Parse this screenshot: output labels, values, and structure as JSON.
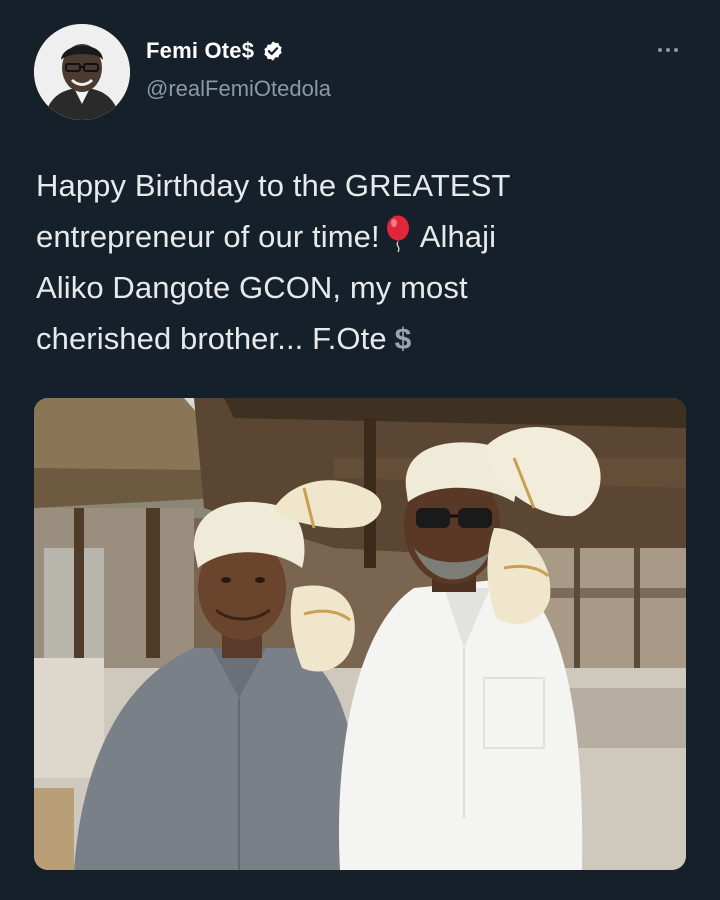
{
  "tweet": {
    "author": {
      "display_name": "Femi Ote$",
      "handle": "@realFemiOtedola",
      "verified": true
    },
    "text": {
      "line1": "Happy Birthday to the GREATEST",
      "line2_start": "entrepreneur of our time!",
      "line2_end": "Alhaji",
      "line3": "Aliko Dangote GCON, my most",
      "line4": "cherished brother... F.Ote",
      "line4_symbol": "$"
    },
    "icons": {
      "more": "more-options-icon",
      "verified": "verified-badge-icon",
      "emoji": "balloon-emoji-icon"
    },
    "colors": {
      "background": "#15202b",
      "text": "#e7e9ea",
      "secondary_text": "#8b98a5",
      "verified_badge": "#ffffff"
    }
  }
}
